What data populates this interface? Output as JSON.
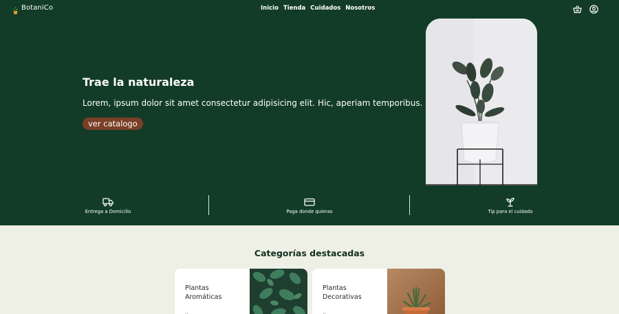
{
  "brand": {
    "name": "BotaniCo",
    "icon": "potted-plant-icon"
  },
  "nav": {
    "links": [
      "Inicio",
      "Tienda",
      "Cuidados",
      "Nosotros"
    ]
  },
  "header_icons": {
    "cart": "basket-icon",
    "account": "user-circle-icon"
  },
  "hero": {
    "title": "Trae la naturaleza",
    "text": "Lorem, ipsum dolor sit amet consectetur adipisicing elit. Hic, aperiam temporibus.",
    "button": "ver catalogo",
    "image": "plant-in-white-pot-on-stand"
  },
  "features": [
    {
      "label": "Entrega a Domicilio",
      "icon": "truck-icon"
    },
    {
      "label": "Paga donde quieras",
      "icon": "credit-card-icon"
    },
    {
      "label": "Tip para el cuidado",
      "icon": "sprout-icon"
    }
  ],
  "categories": {
    "title": "Categorías destacadas",
    "items": [
      {
        "line1": "Plantas",
        "line2": "Aromáticas",
        "more": "··",
        "image": "green-leaves-photo"
      },
      {
        "line1": "Plantas",
        "line2": "Decorativas",
        "more": "··",
        "image": "succulent-in-terracotta-pot-photo"
      }
    ]
  },
  "colors": {
    "primary_green": "#123c28",
    "accent_brown": "#7b3e26",
    "page_background": "#eef0e6"
  }
}
